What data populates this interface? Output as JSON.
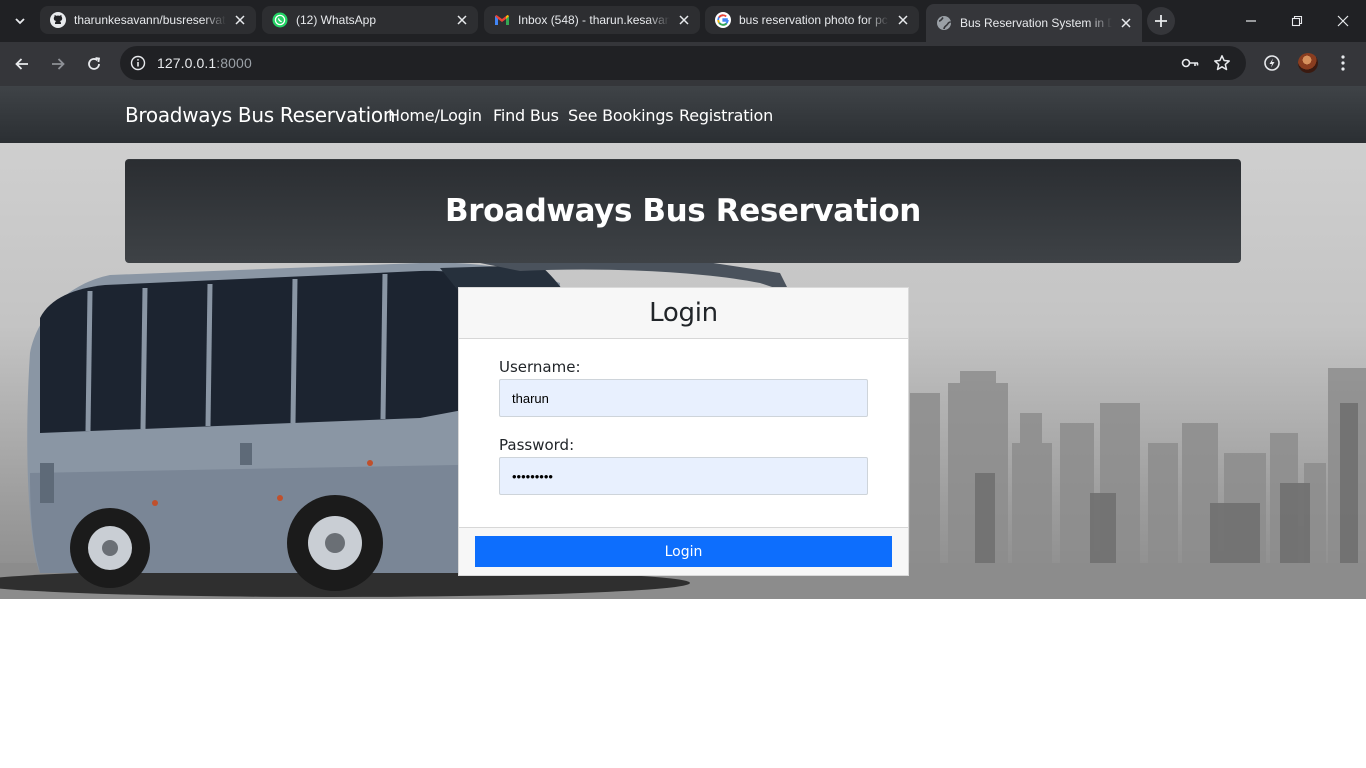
{
  "browser": {
    "tabs": [
      {
        "title": "tharunkesavann/busreservat",
        "icon": "github-icon"
      },
      {
        "title": "(12) WhatsApp",
        "icon": "whatsapp-icon"
      },
      {
        "title": "Inbox (548) - tharun.kesavan",
        "icon": "gmail-icon"
      },
      {
        "title": "bus reservation photo for pc",
        "icon": "google-icon"
      },
      {
        "title": "Bus Reservation System in D",
        "icon": "globe-icon",
        "active": true
      }
    ],
    "url_host": "127.0.0.1",
    "url_port": ":8000"
  },
  "navbar": {
    "brand": "Broadways Bus Reservation",
    "links": [
      "Home/Login",
      "Find Bus",
      "See Bookings",
      "Registration"
    ]
  },
  "banner": {
    "title": "Broadways Bus Reservation"
  },
  "login": {
    "heading": "Login",
    "username_label": "Username:",
    "username_value": "tharun",
    "password_label": "Password:",
    "password_value": "•••••••••",
    "button": "Login"
  },
  "colors": {
    "primary_button": "#0d6efd",
    "navbar": "#343a40",
    "autofill": "#e8f0fe"
  }
}
